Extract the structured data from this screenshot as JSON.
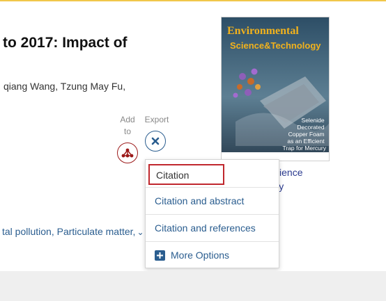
{
  "article": {
    "title_fragment": "to 2017: Impact of",
    "authors_fragment": "qiang Wang, Tzung May Fu,",
    "keywords_fragment": "tal pollution, Particulate matter,"
  },
  "toolbar": {
    "add_label": "Add to",
    "export_label": "Export"
  },
  "export_menu": {
    "items": [
      "Citation",
      "Citation and abstract",
      "Citation and references"
    ],
    "more_options": "More Options"
  },
  "journal": {
    "cover_title_line1": "Environmental",
    "cover_title_line2": "Science&Technology",
    "cover_caption": [
      "Selenide",
      "Decorated",
      "Copper Foam",
      "as an Efficient",
      "Trap for Mercury"
    ],
    "name_line1": "tal Science",
    "name_line2": "nology"
  },
  "colors": {
    "link": "#2a5d8f",
    "add_red": "#9c1a1a",
    "highlight_red": "#c0272d",
    "top_accent": "#f1c74a",
    "cover_title": "#f2b21c"
  },
  "icons": {
    "add": "network-nodes-icon",
    "export_close": "close-icon",
    "keywords_toggle": "chevron-down-icon",
    "more_options": "plus-square-icon"
  }
}
